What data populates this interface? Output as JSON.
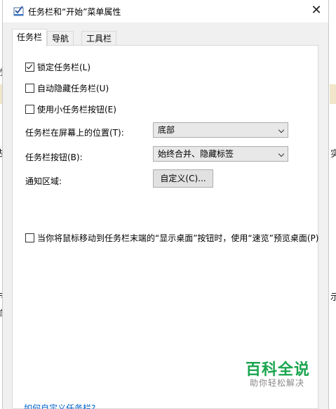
{
  "window": {
    "title": "任务栏和“开始”菜单属性",
    "close_glyph": "✕"
  },
  "tabs": [
    {
      "label": "任务栏",
      "active": true
    },
    {
      "label": "导航",
      "active": false
    },
    {
      "label": "工具栏",
      "active": false
    }
  ],
  "options": {
    "lock_taskbar": {
      "label": "锁定任务栏(L)",
      "checked": true
    },
    "autohide": {
      "label": "自动隐藏任务栏(U)",
      "checked": false
    },
    "small_buttons": {
      "label": "使用小任务栏按钮(E)",
      "checked": false
    },
    "peek": {
      "label": "当你将鼠标移动到任务栏末端的“显示桌面”按钮时，使用“速览”预览桌面(P)",
      "checked": false
    }
  },
  "position": {
    "label": "任务栏在屏幕上的位置(T):",
    "value": "底部"
  },
  "buttons_setting": {
    "label": "任务栏按钮(B):",
    "value": "始终合并、隐藏标签"
  },
  "notification_area": {
    "label": "通知区域:",
    "customize_button": "自定义(C)..."
  },
  "watermark": {
    "title": "百科全说",
    "subtitle": "助你轻松解决"
  },
  "help_link": "如何自定义任务栏?",
  "background_fragments": {
    "a": "才",
    "b": "去",
    "c": "示",
    "d": "单",
    "e": "示",
    "f": "实"
  },
  "colors": {
    "accent_green": "#1aa54f",
    "link_blue": "#0066cc",
    "panel_bg": "#f0f0f0"
  }
}
